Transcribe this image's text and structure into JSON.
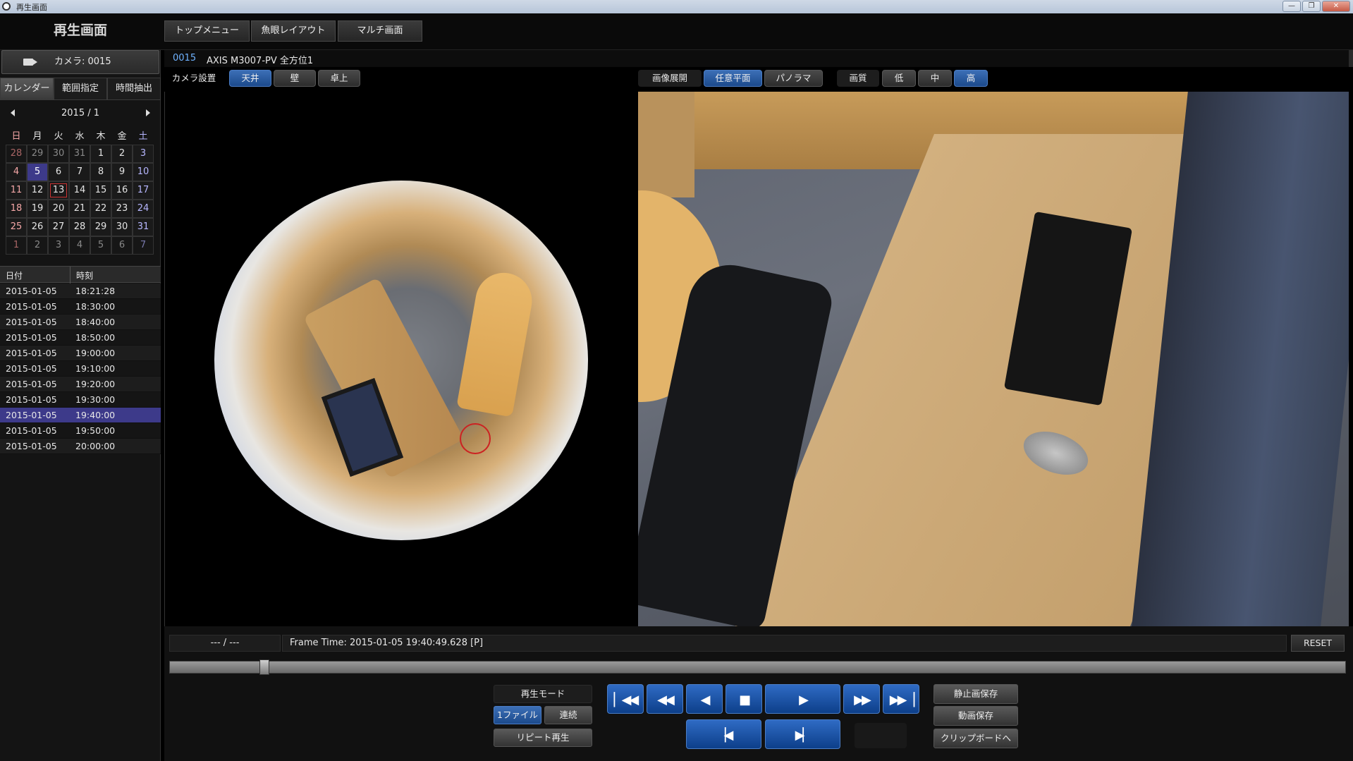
{
  "window": {
    "title": "再生画面",
    "buttons": [
      "—",
      "❐",
      "✕"
    ]
  },
  "header": {
    "app_name": "再生画面",
    "tabs": [
      "トップメニュー",
      "魚眼レイアウト",
      "マルチ画面"
    ]
  },
  "sidebar": {
    "camera_label": "カメラ:  0015",
    "tabs": [
      "カレンダー",
      "範囲指定",
      "時間抽出"
    ],
    "calendar": {
      "month": "2015 / 1",
      "weekdays": [
        "日",
        "月",
        "火",
        "水",
        "木",
        "金",
        "土"
      ],
      "weeks": [
        [
          "28",
          "29",
          "30",
          "31",
          "1",
          "2",
          "3"
        ],
        [
          "4",
          "5",
          "6",
          "7",
          "8",
          "9",
          "10"
        ],
        [
          "11",
          "12",
          "13",
          "14",
          "15",
          "16",
          "17"
        ],
        [
          "18",
          "19",
          "20",
          "21",
          "22",
          "23",
          "24"
        ],
        [
          "25",
          "26",
          "27",
          "28",
          "29",
          "30",
          "31"
        ],
        [
          "1",
          "2",
          "3",
          "4",
          "5",
          "6",
          "7"
        ]
      ],
      "recorded_day": "5",
      "today": "13"
    },
    "list": {
      "headers": [
        "日付",
        "時刻"
      ],
      "rows": [
        [
          "2015-01-05",
          "18:21:28"
        ],
        [
          "2015-01-05",
          "18:30:00"
        ],
        [
          "2015-01-05",
          "18:40:00"
        ],
        [
          "2015-01-05",
          "18:50:00"
        ],
        [
          "2015-01-05",
          "19:00:00"
        ],
        [
          "2015-01-05",
          "19:10:00"
        ],
        [
          "2015-01-05",
          "19:20:00"
        ],
        [
          "2015-01-05",
          "19:30:00"
        ],
        [
          "2015-01-05",
          "19:40:00"
        ],
        [
          "2015-01-05",
          "19:50:00"
        ],
        [
          "2015-01-05",
          "20:00:00"
        ]
      ],
      "selected_index": 8
    }
  },
  "main": {
    "camera_id": "0015",
    "camera_name": "AXIS M3007-PV 全方位1",
    "camera_setting": {
      "label": "カメラ設置",
      "options": [
        "天井",
        "壁",
        "卓上"
      ],
      "selected": "天井"
    },
    "image_expand": {
      "label": "画像展開",
      "options": [
        "任意平面",
        "パノラマ"
      ],
      "selected": "任意平面"
    },
    "quality": {
      "label": "画質",
      "options": [
        "低",
        "中",
        "高"
      ],
      "selected": "高"
    }
  },
  "playback": {
    "counter": "--- / ---",
    "frame_time": "Frame Time:  2015-01-05 19:40:49.628    [P]",
    "reset_label": "RESET",
    "seek_position": 0.08,
    "mode_label": "再生モード",
    "mode_options": [
      "1ファイル",
      "連続"
    ],
    "mode_selected": "1ファイル",
    "repeat_label": "リピート再生",
    "save_still_label": "静止画保存",
    "save_video_label": "動画保存",
    "clipboard_label": "クリップボードへ"
  },
  "colors": {
    "accent_blue": "#1c4a8c",
    "selection_purple": "#3d3a8a",
    "camera_id_blue": "#6fb3ff"
  }
}
